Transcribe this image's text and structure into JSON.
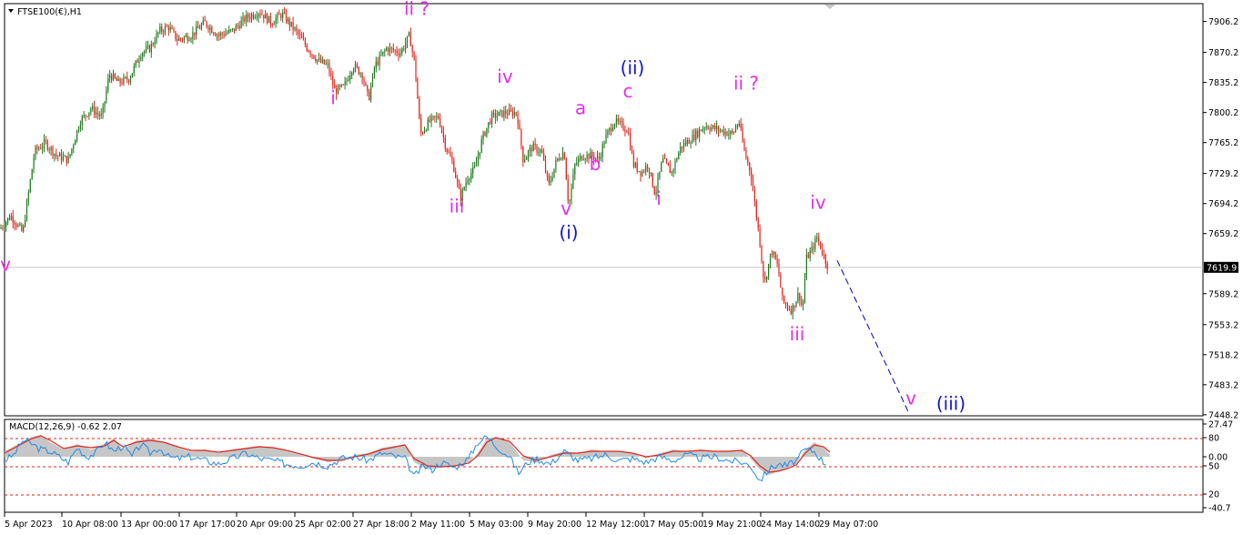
{
  "header": {
    "symbol_label": "FTSE100(€),H1",
    "indicator_label": "MACD(12,26,9) -0.62 2.07"
  },
  "price": {
    "current_label": "7619.9",
    "current_value": 7619.9
  },
  "colors": {
    "bull_candle": "#1e7a1e",
    "bear_candle": "#e0241b",
    "wave_magenta": "#e62ee6",
    "wave_blue": "#1414c8",
    "forecast_line": "#1414c8",
    "macd_hist": "#c0c0c0",
    "macd_signal": "#e0241b",
    "macd_line": "#1e8be6",
    "level_line": "#e0241b"
  },
  "chart_data": [
    {
      "type": "candlestick",
      "y_ticks": [
        "7906.2",
        "7870.2",
        "7835.2",
        "7800.2",
        "7765.2",
        "7729.2",
        "7694.2",
        "7659.2",
        "7589.2",
        "7553.2",
        "7518.2",
        "7483.2",
        "7448.2"
      ],
      "ylim": [
        7447,
        7927
      ],
      "x_labels": [
        "5 Apr 2023",
        "10 Apr 08:00",
        "13 Apr 00:00",
        "17 Apr 17:00",
        "20 Apr 09:00",
        "25 Apr 02:00",
        "27 Apr 18:00",
        "2 May 11:00",
        "5 May 03:00",
        "9 May 20:00",
        "12 May 12:00",
        "17 May 05:00",
        "19 May 21:00",
        "24 May 14:00",
        "29 May 07:00"
      ],
      "close_path": [
        [
          0,
          7665
        ],
        [
          12,
          7680
        ],
        [
          25,
          7660
        ],
        [
          38,
          7755
        ],
        [
          50,
          7765
        ],
        [
          62,
          7750
        ],
        [
          75,
          7745
        ],
        [
          88,
          7790
        ],
        [
          100,
          7805
        ],
        [
          112,
          7795
        ],
        [
          120,
          7845
        ],
        [
          130,
          7835
        ],
        [
          142,
          7840
        ],
        [
          155,
          7870
        ],
        [
          165,
          7875
        ],
        [
          175,
          7895
        ],
        [
          185,
          7900
        ],
        [
          195,
          7885
        ],
        [
          210,
          7890
        ],
        [
          225,
          7905
        ],
        [
          240,
          7890
        ],
        [
          255,
          7895
        ],
        [
          270,
          7910
        ],
        [
          285,
          7918
        ],
        [
          298,
          7905
        ],
        [
          310,
          7915
        ],
        [
          325,
          7895
        ],
        [
          338,
          7875
        ],
        [
          350,
          7860
        ],
        [
          360,
          7855
        ],
        [
          368,
          7825
        ],
        [
          378,
          7830
        ],
        [
          388,
          7855
        ],
        [
          398,
          7845
        ],
        [
          405,
          7815
        ],
        [
          412,
          7855
        ],
        [
          425,
          7875
        ],
        [
          440,
          7870
        ],
        [
          450,
          7890
        ],
        [
          456,
          7855
        ],
        [
          462,
          7775
        ],
        [
          472,
          7790
        ],
        [
          482,
          7795
        ],
        [
          490,
          7760
        ],
        [
          498,
          7740
        ],
        [
          506,
          7700
        ],
        [
          514,
          7725
        ],
        [
          522,
          7735
        ],
        [
          530,
          7770
        ],
        [
          540,
          7795
        ],
        [
          555,
          7800
        ],
        [
          568,
          7800
        ],
        [
          575,
          7745
        ],
        [
          585,
          7760
        ],
        [
          595,
          7755
        ],
        [
          603,
          7715
        ],
        [
          612,
          7745
        ],
        [
          620,
          7755
        ],
        [
          625,
          7690
        ],
        [
          632,
          7740
        ],
        [
          640,
          7750
        ],
        [
          650,
          7750
        ],
        [
          658,
          7745
        ],
        [
          665,
          7770
        ],
        [
          675,
          7790
        ],
        [
          690,
          7780
        ],
        [
          696,
          7740
        ],
        [
          705,
          7730
        ],
        [
          712,
          7740
        ],
        [
          720,
          7705
        ],
        [
          728,
          7745
        ],
        [
          738,
          7730
        ],
        [
          748,
          7760
        ],
        [
          760,
          7770
        ],
        [
          775,
          7785
        ],
        [
          790,
          7780
        ],
        [
          805,
          7775
        ],
        [
          812,
          7790
        ],
        [
          818,
          7755
        ],
        [
          825,
          7730
        ],
        [
          830,
          7690
        ],
        [
          835,
          7650
        ],
        [
          840,
          7600
        ],
        [
          848,
          7640
        ],
        [
          855,
          7620
        ],
        [
          860,
          7580
        ],
        [
          870,
          7570
        ],
        [
          878,
          7590
        ],
        [
          882,
          7570
        ],
        [
          886,
          7630
        ],
        [
          892,
          7640
        ],
        [
          898,
          7655
        ],
        [
          903,
          7640
        ],
        [
          910,
          7620
        ]
      ],
      "current_price": 7619.9,
      "forecast": [
        [
          920,
          7628
        ],
        [
          998,
          7452
        ]
      ],
      "wave_labels": [
        {
          "text": "v",
          "x": 6,
          "y": 7616,
          "color": "magenta"
        },
        {
          "text": "ii ?",
          "x": 458,
          "y": 7914,
          "color": "magenta"
        },
        {
          "text": "i",
          "x": 366,
          "y": 7810,
          "color": "magenta"
        },
        {
          "text": "iii",
          "x": 502,
          "y": 7684,
          "color": "magenta"
        },
        {
          "text": "iv",
          "x": 555,
          "y": 7835,
          "color": "magenta"
        },
        {
          "text": "v",
          "x": 622,
          "y": 7681,
          "color": "magenta"
        },
        {
          "text": "(i)",
          "x": 625,
          "y": 7653,
          "color": "blue"
        },
        {
          "text": "a",
          "x": 638,
          "y": 7798,
          "color": "magenta"
        },
        {
          "text": "b",
          "x": 654,
          "y": 7733,
          "color": "magenta"
        },
        {
          "text": "c",
          "x": 690,
          "y": 7818,
          "color": "magenta"
        },
        {
          "text": "(ii)",
          "x": 695,
          "y": 7845,
          "color": "blue"
        },
        {
          "text": "i",
          "x": 724,
          "y": 7693,
          "color": "magenta"
        },
        {
          "text": "ii ?",
          "x": 820,
          "y": 7827,
          "color": "magenta"
        },
        {
          "text": "iv",
          "x": 899,
          "y": 7688,
          "color": "magenta"
        },
        {
          "text": "iii",
          "x": 876,
          "y": 7535,
          "color": "magenta"
        },
        {
          "text": "v",
          "x": 1001,
          "y": 7460,
          "color": "magenta"
        },
        {
          "text": "(iii)",
          "x": 1045,
          "y": 7454,
          "color": "blue"
        }
      ]
    },
    {
      "type": "line",
      "title": "MACD(12,26,9) -0.62 2.07",
      "y_ticks": [
        "27.47",
        "80",
        "0.00",
        "50",
        "20",
        "-40.7"
      ],
      "ylim": [
        -40.7,
        27.47
      ],
      "levels": [
        80,
        50,
        20
      ],
      "histogram": [
        [
          5,
          6
        ],
        [
          20,
          14
        ],
        [
          35,
          22
        ],
        [
          45,
          24
        ],
        [
          55,
          16
        ],
        [
          70,
          8
        ],
        [
          85,
          14
        ],
        [
          100,
          8
        ],
        [
          115,
          14
        ],
        [
          125,
          20
        ],
        [
          135,
          8
        ],
        [
          150,
          18
        ],
        [
          165,
          20
        ],
        [
          180,
          16
        ],
        [
          195,
          10
        ],
        [
          210,
          6
        ],
        [
          225,
          8
        ],
        [
          240,
          4
        ],
        [
          255,
          8
        ],
        [
          270,
          10
        ],
        [
          285,
          12
        ],
        [
          300,
          10
        ],
        [
          315,
          6
        ],
        [
          330,
          2
        ],
        [
          345,
          -2
        ],
        [
          360,
          -6
        ],
        [
          375,
          -4
        ],
        [
          390,
          2
        ],
        [
          405,
          4
        ],
        [
          420,
          10
        ],
        [
          435,
          12
        ],
        [
          445,
          14
        ],
        [
          455,
          -6
        ],
        [
          470,
          -14
        ],
        [
          485,
          -12
        ],
        [
          500,
          -10
        ],
        [
          515,
          -6
        ],
        [
          525,
          4
        ],
        [
          535,
          20
        ],
        [
          545,
          22
        ],
        [
          560,
          16
        ],
        [
          575,
          -4
        ],
        [
          590,
          -6
        ],
        [
          605,
          2
        ],
        [
          620,
          6
        ],
        [
          635,
          4
        ],
        [
          650,
          8
        ],
        [
          665,
          6
        ],
        [
          680,
          6
        ],
        [
          695,
          4
        ],
        [
          710,
          -2
        ],
        [
          725,
          4
        ],
        [
          740,
          8
        ],
        [
          755,
          6
        ],
        [
          770,
          8
        ],
        [
          785,
          6
        ],
        [
          800,
          6
        ],
        [
          815,
          8
        ],
        [
          825,
          -2
        ],
        [
          835,
          -14
        ],
        [
          845,
          -20
        ],
        [
          855,
          -16
        ],
        [
          865,
          -12
        ],
        [
          875,
          -8
        ],
        [
          885,
          8
        ],
        [
          895,
          16
        ],
        [
          905,
          10
        ],
        [
          912,
          2
        ]
      ],
      "signal": [
        [
          5,
          4
        ],
        [
          20,
          12
        ],
        [
          35,
          20
        ],
        [
          45,
          23
        ],
        [
          55,
          18
        ],
        [
          70,
          9
        ],
        [
          85,
          12
        ],
        [
          100,
          10
        ],
        [
          115,
          12
        ],
        [
          125,
          18
        ],
        [
          135,
          11
        ],
        [
          150,
          16
        ],
        [
          165,
          18
        ],
        [
          180,
          16
        ],
        [
          195,
          11
        ],
        [
          210,
          7
        ],
        [
          225,
          7
        ],
        [
          240,
          5
        ],
        [
          255,
          7
        ],
        [
          270,
          9
        ],
        [
          285,
          11
        ],
        [
          300,
          10
        ],
        [
          315,
          7
        ],
        [
          330,
          3
        ],
        [
          345,
          -1
        ],
        [
          360,
          -4
        ],
        [
          375,
          -4
        ],
        [
          390,
          0
        ],
        [
          405,
          3
        ],
        [
          420,
          8
        ],
        [
          435,
          11
        ],
        [
          445,
          13
        ],
        [
          455,
          -2
        ],
        [
          470,
          -10
        ],
        [
          485,
          -11
        ],
        [
          500,
          -10
        ],
        [
          515,
          -7
        ],
        [
          525,
          1
        ],
        [
          535,
          16
        ],
        [
          545,
          21
        ],
        [
          560,
          17
        ],
        [
          575,
          1
        ],
        [
          590,
          -4
        ],
        [
          605,
          0
        ],
        [
          620,
          4
        ],
        [
          635,
          4
        ],
        [
          650,
          6
        ],
        [
          665,
          6
        ],
        [
          680,
          6
        ],
        [
          695,
          4
        ],
        [
          710,
          0
        ],
        [
          725,
          2
        ],
        [
          740,
          6
        ],
        [
          755,
          6
        ],
        [
          770,
          7
        ],
        [
          785,
          6
        ],
        [
          800,
          6
        ],
        [
          815,
          7
        ],
        [
          825,
          1
        ],
        [
          835,
          -10
        ],
        [
          845,
          -17
        ],
        [
          855,
          -16
        ],
        [
          865,
          -13
        ],
        [
          875,
          -9
        ],
        [
          885,
          4
        ],
        [
          895,
          13
        ],
        [
          905,
          11
        ],
        [
          912,
          5
        ]
      ],
      "macd": [
        [
          5,
          -4
        ],
        [
          15,
          2
        ],
        [
          25,
          18
        ],
        [
          35,
          14
        ],
        [
          45,
          8
        ],
        [
          55,
          6
        ],
        [
          65,
          0
        ],
        [
          75,
          -6
        ],
        [
          85,
          10
        ],
        [
          95,
          0
        ],
        [
          105,
          4
        ],
        [
          115,
          16
        ],
        [
          125,
          6
        ],
        [
          135,
          12
        ],
        [
          145,
          0
        ],
        [
          155,
          14
        ],
        [
          165,
          4
        ],
        [
          175,
          10
        ],
        [
          185,
          0
        ],
        [
          195,
          -2
        ],
        [
          210,
          0
        ],
        [
          225,
          -4
        ],
        [
          240,
          -8
        ],
        [
          255,
          -2
        ],
        [
          270,
          4
        ],
        [
          285,
          -2
        ],
        [
          300,
          -4
        ],
        [
          315,
          -8
        ],
        [
          330,
          -10
        ],
        [
          345,
          -6
        ],
        [
          360,
          -10
        ],
        [
          375,
          -2
        ],
        [
          390,
          0
        ],
        [
          405,
          -4
        ],
        [
          420,
          4
        ],
        [
          435,
          0
        ],
        [
          445,
          -2
        ],
        [
          455,
          -22
        ],
        [
          465,
          -10
        ],
        [
          475,
          -14
        ],
        [
          485,
          -6
        ],
        [
          500,
          -12
        ],
        [
          515,
          -2
        ],
        [
          525,
          16
        ],
        [
          535,
          22
        ],
        [
          545,
          12
        ],
        [
          560,
          0
        ],
        [
          570,
          -18
        ],
        [
          580,
          -6
        ],
        [
          590,
          -2
        ],
        [
          605,
          -8
        ],
        [
          620,
          6
        ],
        [
          635,
          -4
        ],
        [
          650,
          -2
        ],
        [
          665,
          2
        ],
        [
          680,
          -4
        ],
        [
          695,
          -2
        ],
        [
          710,
          -6
        ],
        [
          725,
          0
        ],
        [
          740,
          -4
        ],
        [
          755,
          2
        ],
        [
          770,
          -2
        ],
        [
          785,
          0
        ],
        [
          800,
          -4
        ],
        [
          815,
          -6
        ],
        [
          825,
          -10
        ],
        [
          835,
          -26
        ],
        [
          845,
          -14
        ],
        [
          855,
          -8
        ],
        [
          865,
          -10
        ],
        [
          875,
          -4
        ],
        [
          885,
          8
        ],
        [
          895,
          6
        ],
        [
          905,
          -6
        ],
        [
          910,
          -8
        ]
      ]
    }
  ]
}
